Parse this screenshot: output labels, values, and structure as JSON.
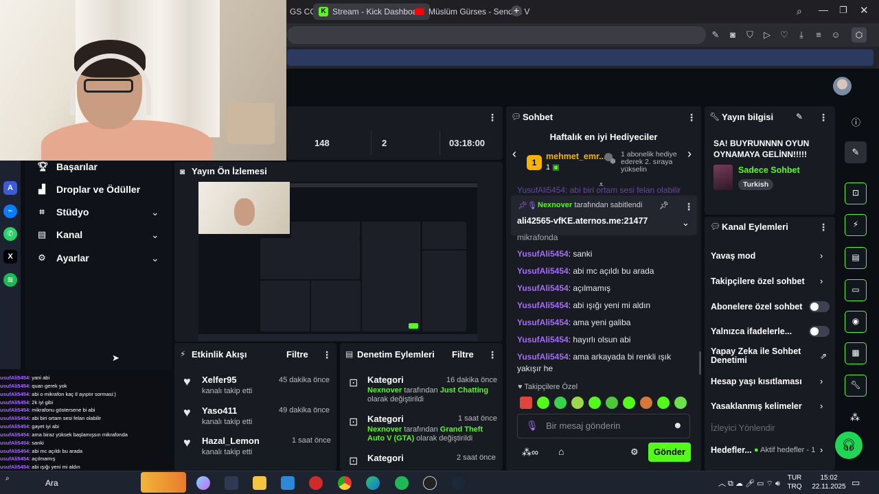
{
  "browser": {
    "tabs": [
      {
        "label": "GS COG"
      },
      {
        "label": "Stream - Kick Dashboard"
      },
      {
        "label": "Müslüm Gürses - Senden V"
      }
    ],
    "new_tab": "+"
  },
  "stats": {
    "viewers": "148",
    "followers_new": "2",
    "uptime": "03:18:00"
  },
  "sidebar": {
    "items": [
      {
        "label": "Başarılar"
      },
      {
        "label": "Droplar ve Ödüller"
      },
      {
        "label": "Stüdyo"
      },
      {
        "label": "Kanal"
      },
      {
        "label": "Ayarlar"
      }
    ]
  },
  "overlay_chat": [
    {
      "user": "usufAli5454",
      "text": ": yani abi"
    },
    {
      "user": "usufAli5454",
      "text": ": quan gerek yok"
    },
    {
      "user": "usufAli5454",
      "text": ": abi o mikrafon kaç tl ayıptır sormasi:)"
    },
    {
      "user": "usufAli5454",
      "text": ": 2k iyi gibi"
    },
    {
      "user": "usufAli5454",
      "text": ": mikrafonu göstersene bi abi"
    },
    {
      "user": "usufAli5454",
      "text": ": abi biri ortam sesi felan olabilir"
    },
    {
      "user": "usufAli5454",
      "text": ": gayet iyi abi"
    },
    {
      "user": "usufAli5454",
      "text": ": ama biraz yüksek başlamışsın mikrafonda"
    },
    {
      "user": "usufAli5454",
      "text": ": sanki"
    },
    {
      "user": "usufAli5454",
      "text": ": abi mc açıldı bu arada"
    },
    {
      "user": "usufAli5454",
      "text": ": açılmamış"
    },
    {
      "user": "usufAli5454",
      "text": ": abi ışığı yeni mi aldın"
    }
  ],
  "preview": {
    "title": "Yayın Ön İzlemesi"
  },
  "activity": {
    "title": "Etkinlik Akışı",
    "filter": "Filtre",
    "items": [
      {
        "user": "Xelfer95",
        "action": "kanalı takip etti",
        "time": "45 dakika önce"
      },
      {
        "user": "Yaso411",
        "action": "kanalı takip etti",
        "time": "49 dakika önce"
      },
      {
        "user": "Hazal_Lemon",
        "action": "kanalı takip etti",
        "time": "1 saat önce"
      }
    ]
  },
  "moderation": {
    "title": "Denetim Eylemleri",
    "filter": "Filtre",
    "items": [
      {
        "kind": "Kategori",
        "time": "16 dakika önce",
        "mod": "Nexnover",
        "mid": " tarafından ",
        "value": "Just Chatting",
        "tail": "olarak değiştirildi"
      },
      {
        "kind": "Kategori",
        "time": "1 saat önce",
        "mod": "Nexnover",
        "mid": " tarafından ",
        "value": "Grand Theft Auto V (GTA)",
        "tail": " olarak değiştirildi"
      },
      {
        "kind": "Kategori",
        "time": "2 saat önce"
      }
    ]
  },
  "chat": {
    "title": "Sohbet",
    "top_gifters": "Haftalık en iyi Hediyeciler",
    "gifter_name": "mehmet_emr...",
    "gifter_rank": "1",
    "gifter_count": "1",
    "gifter_note": "1 abonelik hediye ederek 2. sıraya yükselin",
    "pinned_by_user": "Nexnover",
    "pinned_by_text": " tarafından sabitlendi",
    "pinned_message": "ali42565-vfKE.aternos.me:21477",
    "partial_top": "YusufAli5454: abi biri ortam sesi felan olabilir",
    "partial_mid": "mikrafonda",
    "messages": [
      {
        "user": "YusufAli5454",
        "text": ": sanki"
      },
      {
        "user": "YusufAli5454",
        "text": ": abi mc açıldı bu arada"
      },
      {
        "user": "YusufAli5454",
        "text": ": açılmamış"
      },
      {
        "user": "YusufAli5454",
        "text": ": abi ışığı yeni mi aldın"
      },
      {
        "user": "YusufAli5454",
        "text": ": ama yeni galiba"
      },
      {
        "user": "YusufAli5454",
        "text": ": hayırlı olsun abi"
      },
      {
        "user": "YusufAli5454",
        "text": ": ama arkayada bi renkli ışık yakışır he"
      }
    ],
    "followers_only": "Takipçilere Özel",
    "input_placeholder": "Bir mesaj gönderin",
    "send": "Gönder"
  },
  "stream_info": {
    "title": "Yayın bilgisi",
    "stream_title": "SA! BUYRUNNNN OYUN OYNAMAYA GELİNN!!!!!",
    "category": "Sadece Sohbet",
    "language": "Turkish"
  },
  "channel_actions": {
    "title": "Kanal Eylemleri",
    "items": [
      {
        "label": "Yavaş mod"
      },
      {
        "label": "Takipçilere özel sohbet"
      },
      {
        "label": "Abonelere özel sohbet"
      },
      {
        "label": "Yalnızca ifadelerle..."
      },
      {
        "label": "Yapay Zeka ile Sohbet Denetimi"
      },
      {
        "label": "Hesap yaşı kısıtlaması"
      },
      {
        "label": "Yasaklanmış kelimeler"
      },
      {
        "label": "İzleyici Yönlendir"
      },
      {
        "label": "Hedefler..."
      }
    ],
    "active_goals": "Aktif hedefler - 1"
  },
  "taskbar": {
    "search": "Ara",
    "lang_top": "TUR",
    "lang_bottom": "TRQ",
    "time": "15:02",
    "date": "22.11.2025"
  },
  "colors": {
    "accent": "#53fc18",
    "username": "#a86bff",
    "panel": "#191b22"
  }
}
